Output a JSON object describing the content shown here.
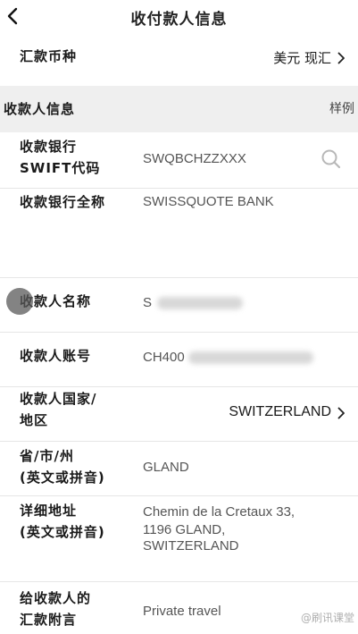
{
  "header": {
    "title": "收付款人信息"
  },
  "currency_row": {
    "label": "汇款币种",
    "value": "美元 现汇"
  },
  "section": {
    "title": "收款人信息",
    "example_link": "样例"
  },
  "fields": {
    "bank_swift": {
      "label_line1": "收款银行",
      "label_line2": "SWIFT代码",
      "value": "SWQBCHZZXXX"
    },
    "bank_name": {
      "label": "收款银行全称",
      "value": "SWISSQUOTE BANK"
    },
    "payee_name": {
      "label": "收款人名称",
      "value_visible": "S"
    },
    "payee_account": {
      "label": "收款人账号",
      "value_visible": "CH400"
    },
    "payee_country": {
      "label_line1": "收款人国家/",
      "label_line2": "地区",
      "value": "SWITZERLAND"
    },
    "province_city": {
      "label_line1": "省/市/州",
      "label_line2": "(英文或拼音)",
      "value": "GLAND"
    },
    "address": {
      "label_line1": "详细地址",
      "label_line2": "(英文或拼音)",
      "value_line1": "Chemin de la Cretaux 33,",
      "value_line2": "1196 GLAND,",
      "value_line3": "SWITZERLAND"
    },
    "remark": {
      "label_line1": "给收款人的",
      "label_line2": "汇款附言",
      "value": "Private travel"
    }
  },
  "watermark": "@刷讯课堂"
}
